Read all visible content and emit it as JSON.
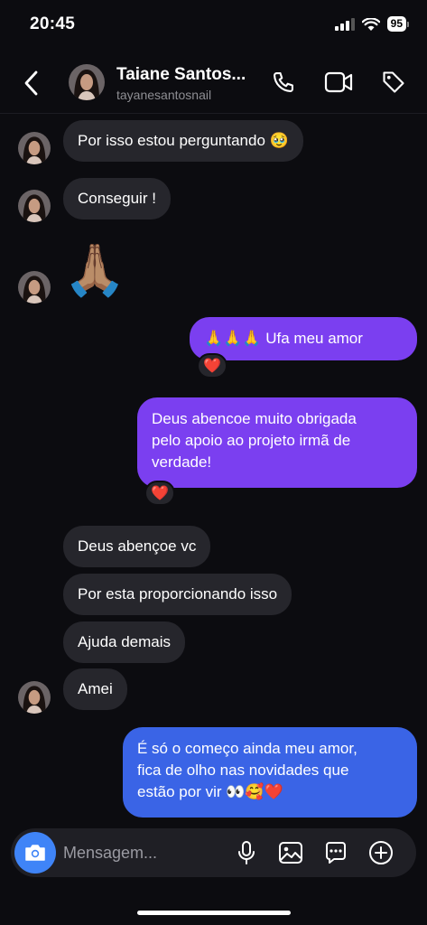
{
  "status_bar": {
    "time": "20:45",
    "battery": "95"
  },
  "header": {
    "name": "Taiane Santos...",
    "username": "tayanesantosnail",
    "icons": [
      "back-icon",
      "phone-icon",
      "video-icon",
      "tag-icon"
    ]
  },
  "messages": [
    {
      "side": "incoming",
      "text": "Por isso estou perguntando 🥹"
    },
    {
      "side": "incoming",
      "text": "Conseguir !"
    },
    {
      "side": "incoming",
      "text": "🙏🏽"
    },
    {
      "side": "outgoing",
      "text": "🙏🙏🙏 Ufa meu amor",
      "reaction": "❤️"
    },
    {
      "side": "outgoing",
      "lines": [
        "Deus abencoe muito obrigada",
        "pelo apoio ao projeto irmã de",
        "verdade!"
      ],
      "reaction": "❤️"
    },
    {
      "side": "incoming",
      "text": "Deus abençoe vc"
    },
    {
      "side": "incoming",
      "text": "Por esta proporcionando isso"
    },
    {
      "side": "incoming",
      "text": "Ajuda demais"
    },
    {
      "side": "incoming",
      "text": "Amei"
    },
    {
      "side": "outgoing",
      "lines": [
        "É só o começo ainda meu amor,",
        "fica de olho nas novidades que",
        "estão por vir 👀🥰❤️"
      ]
    }
  ],
  "composer": {
    "placeholder": "Mensagem...",
    "icons": [
      "camera-icon",
      "microphone-icon",
      "gallery-icon",
      "sticker-icon",
      "add-icon"
    ]
  },
  "colors": {
    "accent_blue": "#3f84f7",
    "bubble_purple": "#7b3ff0",
    "bubble_blue": "#3a64e6",
    "incoming_bubble": "#26262c"
  }
}
